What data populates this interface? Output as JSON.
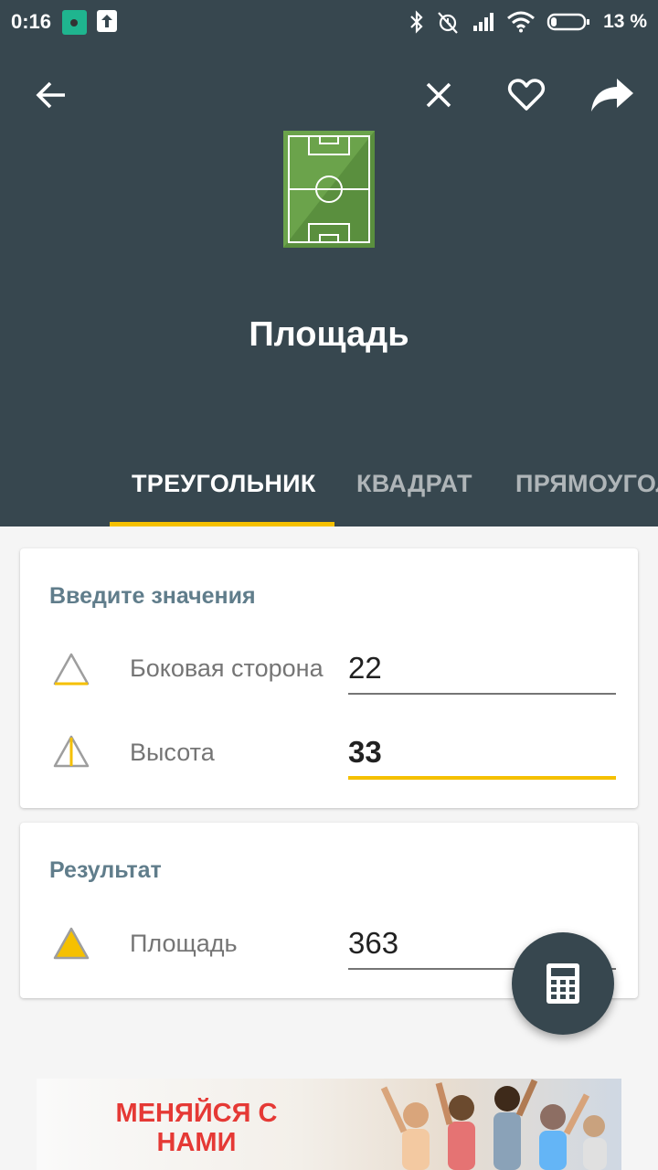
{
  "status_bar": {
    "time": "0:16",
    "battery": "13 %",
    "icons": [
      "app-notification-icon",
      "upload-icon",
      "bluetooth-icon",
      "alarm-off-icon",
      "signal-icon",
      "wifi-icon",
      "battery-icon"
    ]
  },
  "toolbar": {
    "icons": [
      "back-arrow-icon",
      "close-icon",
      "heart-icon",
      "share-icon"
    ]
  },
  "hero": {
    "title": "Площадь",
    "icon": "soccer-field-icon"
  },
  "tabs": [
    {
      "label": "ТРЕУГОЛЬНИК",
      "active": true
    },
    {
      "label": "КВАДРАТ",
      "active": false
    },
    {
      "label": "ПРЯМОУГОЛ",
      "active": false
    }
  ],
  "input_card": {
    "title": "Введите значения",
    "fields": [
      {
        "label": "Боковая сторона",
        "value": "22",
        "icon": "triangle-base-icon"
      },
      {
        "label": "Высота",
        "value": "33",
        "icon": "triangle-height-icon"
      }
    ]
  },
  "result_card": {
    "title": "Результат",
    "fields": [
      {
        "label": "Площадь",
        "value": "363",
        "icon": "triangle-filled-icon"
      }
    ]
  },
  "fab": {
    "icon": "calculator-icon"
  },
  "ad": {
    "line1": "МЕНЯЙСЯ С",
    "line2": "НАМИ"
  },
  "colors": {
    "header": "#37474f",
    "accent": "#f5c000",
    "card_title": "#607d8b",
    "field_green": "#6ba34b"
  }
}
